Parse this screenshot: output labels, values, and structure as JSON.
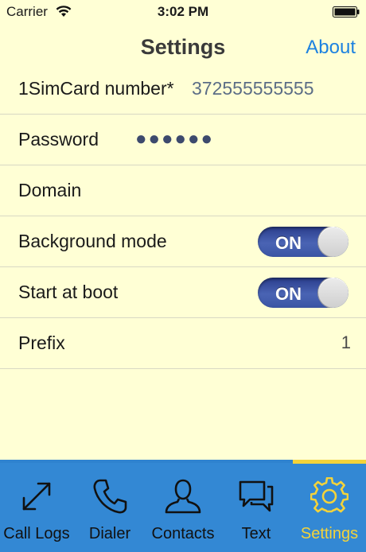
{
  "status_bar": {
    "carrier": "Carrier",
    "time": "3:02 PM",
    "icons": [
      "wifi-icon",
      "battery-icon"
    ]
  },
  "nav": {
    "title": "Settings",
    "about_label": "About"
  },
  "settings": {
    "sim_number": {
      "label": "1SimCard number*",
      "value": "372555555555"
    },
    "password": {
      "label": "Password",
      "value": "●●●●●●"
    },
    "domain": {
      "label": "Domain",
      "value": ""
    },
    "background_mode": {
      "label": "Background mode",
      "toggle_text": "ON",
      "on": true
    },
    "start_at_boot": {
      "label": "Start at boot",
      "toggle_text": "ON",
      "on": true
    },
    "prefix": {
      "label": "Prefix",
      "value": "1"
    }
  },
  "tabs": [
    {
      "label": "Call Logs",
      "icon": "call-logs-icon",
      "active": false
    },
    {
      "label": "Dialer",
      "icon": "phone-icon",
      "active": false
    },
    {
      "label": "Contacts",
      "icon": "contacts-icon",
      "active": false
    },
    {
      "label": "Text",
      "icon": "chat-icon",
      "active": false
    },
    {
      "label": "Settings",
      "icon": "gear-icon",
      "active": true
    }
  ],
  "colors": {
    "background": "#ffffd5",
    "accent": "#1d82e0",
    "tab_bar": "#3388d4",
    "tab_active": "#f4d33a",
    "toggle_on": "#3a54a4"
  }
}
